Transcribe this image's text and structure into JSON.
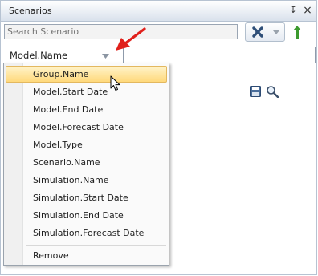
{
  "panel": {
    "title": "Scenarios",
    "pin_glyph": "↧",
    "close_glyph": "×"
  },
  "search": {
    "placeholder": "Search Scenario"
  },
  "toolbar": {
    "clear_icon": "x-icon",
    "dropdown_icon": "chevron-down-icon",
    "move_up_icon": "arrow-up-icon",
    "save_icon": "save-icon",
    "zoom_icon": "magnifier-icon"
  },
  "model_field": {
    "label": "Model.Name",
    "value": ""
  },
  "menu": {
    "items": [
      "Group.Name",
      "Model.Start Date",
      "Model.End Date",
      "Model.Forecast Date",
      "Model.Type",
      "Scenario.Name",
      "Simulation.Name",
      "Simulation.Start Date",
      "Simulation.End Date",
      "Simulation.Forecast Date"
    ],
    "highlighted_index": 0,
    "footer_item": "Remove"
  },
  "colors": {
    "highlight": "#ffd97c",
    "annotation_arrow": "#e0201b",
    "up_arrow": "#3c9a2e",
    "clear_x": "#2f4f78"
  }
}
